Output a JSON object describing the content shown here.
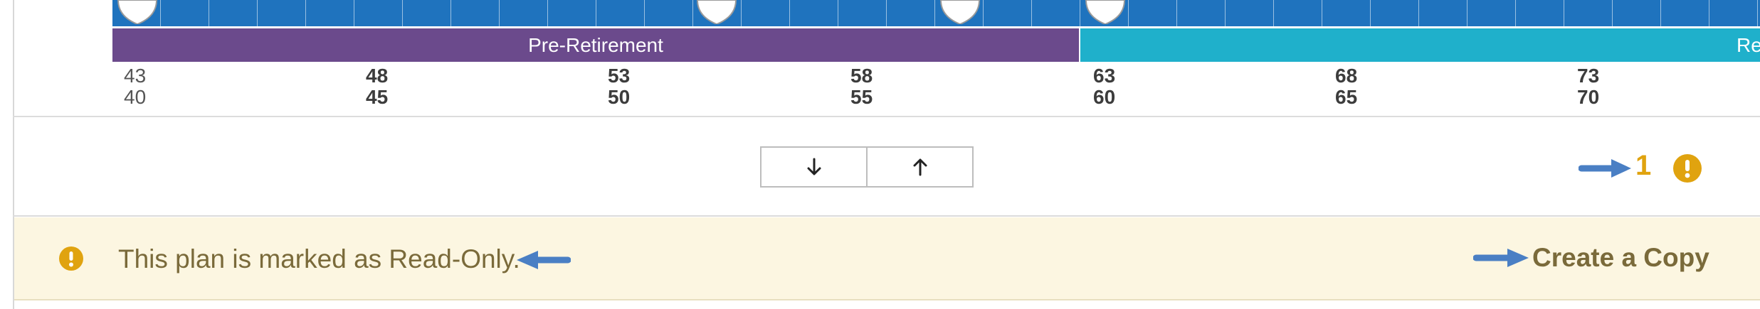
{
  "timeline": {
    "phases": [
      {
        "label": "Pre-Retirement",
        "color": "#6b4a8c"
      },
      {
        "label": "Re",
        "color": "#1fb0cb"
      }
    ],
    "grid_color": "#1f73be",
    "ages": [
      {
        "top": "43",
        "bottom": "40"
      },
      {
        "top": "48",
        "bottom": "45"
      },
      {
        "top": "53",
        "bottom": "50"
      },
      {
        "top": "58",
        "bottom": "55"
      },
      {
        "top": "63",
        "bottom": "60"
      },
      {
        "top": "68",
        "bottom": "65"
      },
      {
        "top": "73",
        "bottom": "70"
      }
    ]
  },
  "controls": {
    "scroll_down_icon": "arrow-down-icon",
    "scroll_up_icon": "arrow-up-icon",
    "issue_count": "1",
    "issue_icon": "warning-circle-icon",
    "accent_color": "#e0a30f"
  },
  "banner": {
    "message": "This plan is marked as Read-Only.",
    "action_label": "Create a Copy",
    "background": "#fcf6e1",
    "text_color": "#7a6a3a"
  }
}
